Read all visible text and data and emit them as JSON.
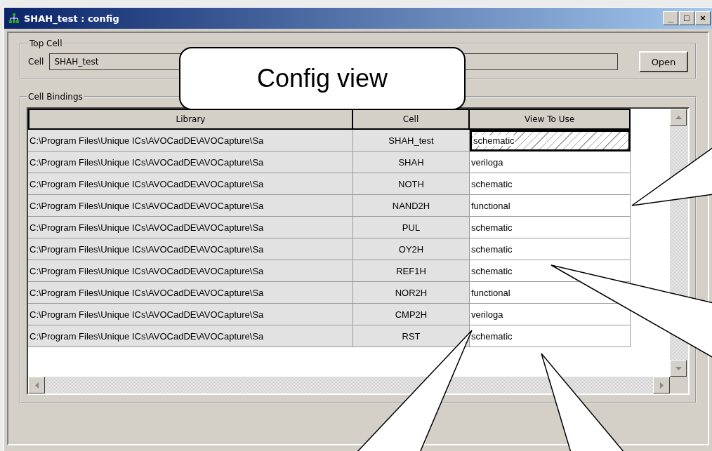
{
  "window": {
    "title": "SHAH_test : config",
    "controls": [
      "_",
      "□",
      "×"
    ]
  },
  "top_cell": {
    "legend": "Top Cell",
    "label": "Cell",
    "value": "SHAH_test",
    "button": "Open"
  },
  "cell_bindings": {
    "legend": "Cell Bindings",
    "table": {
      "columns": [
        "Library",
        "Cell",
        "View To Use"
      ],
      "rows": [
        {
          "library": "C:\\Program Files\\Unique ICs\\AVOCadDE\\AVOCapture\\Sa",
          "cell": "SHAH_test",
          "view": "schematic",
          "selected": true
        },
        {
          "library": "C:\\Program Files\\Unique ICs\\AVOCadDE\\AVOCapture\\Sa",
          "cell": "SHAH",
          "view": "veriloga",
          "selected": false
        },
        {
          "library": "C:\\Program Files\\Unique ICs\\AVOCadDE\\AVOCapture\\Sa",
          "cell": "NOTH",
          "view": "schematic",
          "selected": false
        },
        {
          "library": "C:\\Program Files\\Unique ICs\\AVOCadDE\\AVOCapture\\Sa",
          "cell": "NAND2H",
          "view": "functional",
          "selected": false
        },
        {
          "library": "C:\\Program Files\\Unique ICs\\AVOCadDE\\AVOCapture\\Sa",
          "cell": "PUL",
          "view": "schematic",
          "selected": false
        },
        {
          "library": "C:\\Program Files\\Unique ICs\\AVOCadDE\\AVOCapture\\Sa",
          "cell": "OY2H",
          "view": "schematic",
          "selected": false
        },
        {
          "library": "C:\\Program Files\\Unique ICs\\AVOCadDE\\AVOCapture\\Sa",
          "cell": "REF1H",
          "view": "schematic",
          "selected": false
        },
        {
          "library": "C:\\Program Files\\Unique ICs\\AVOCadDE\\AVOCapture\\Sa",
          "cell": "NOR2H",
          "view": "functional",
          "selected": false
        },
        {
          "library": "C:\\Program Files\\Unique ICs\\AVOCadDE\\AVOCapture\\Sa",
          "cell": "CMP2H",
          "view": "veriloga",
          "selected": false
        },
        {
          "library": "C:\\Program Files\\Unique ICs\\AVOCadDE\\AVOCapture\\Sa",
          "cell": "RST",
          "view": "schematic",
          "selected": false
        }
      ]
    }
  },
  "callout": {
    "text": "Config view"
  }
}
